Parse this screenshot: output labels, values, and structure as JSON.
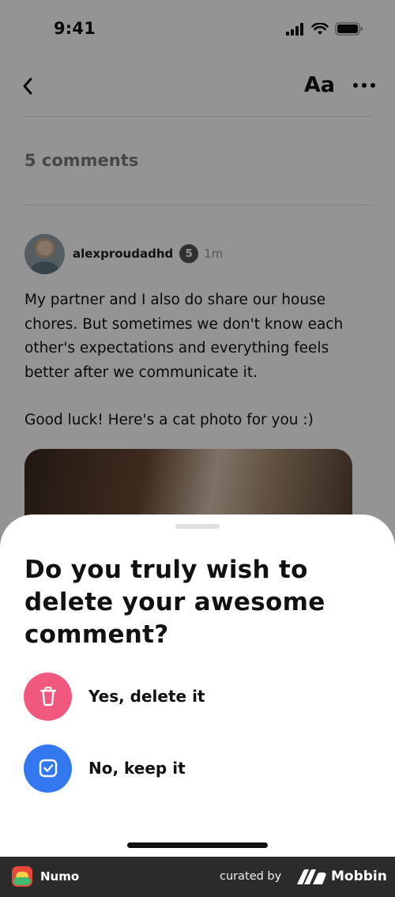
{
  "status_bar": {
    "time": "9:41"
  },
  "nav": {
    "font_label": "Aa"
  },
  "comments": {
    "count_label": "5 comments"
  },
  "comment": {
    "username": "alexproudadhd",
    "level": "5",
    "time_ago": "1m",
    "paragraph_1": "My partner and I also do share our house chores. But sometimes we don't know each other's expectations and everything feels better after we communicate it.",
    "paragraph_2": "Good luck! Here's a cat photo for you :)"
  },
  "sheet": {
    "title": "Do you truly wish to delete your awesome comment?",
    "options": [
      {
        "label": "Yes, delete it",
        "icon": "trash-icon",
        "color": "#f0587d"
      },
      {
        "label": "No, keep it",
        "icon": "checkbox-icon",
        "color": "#3478f0"
      }
    ]
  },
  "footer": {
    "app_name": "Numo",
    "curated_by": "curated by",
    "brand": "Mobbin"
  }
}
